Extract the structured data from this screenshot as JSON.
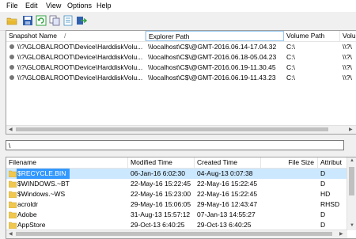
{
  "menu": [
    "File",
    "Edit",
    "View",
    "Options",
    "Help"
  ],
  "toolbar": [
    {
      "name": "open-folder-icon",
      "color": "#e8b830"
    },
    {
      "name": "save-icon",
      "color": "#3060b0"
    },
    {
      "name": "refresh-icon",
      "color": "#30a040"
    },
    {
      "name": "copy-icon",
      "color": "#8080c0"
    },
    {
      "name": "properties-icon",
      "color": "#3a8ac0"
    },
    {
      "name": "exit-icon",
      "color": "#3060b0"
    }
  ],
  "snapshots": {
    "columns": [
      "Snapshot Name",
      "Explorer Path",
      "Volume Path",
      "Volu"
    ],
    "sort_indicator": "/",
    "rows": [
      {
        "name": "\\\\?\\GLOBALROOT\\Device\\HarddiskVolu...",
        "explorer": "\\\\localhost\\C$\\@GMT-2016.06.14-17.04.32",
        "volume": "C:\\",
        "vol2": "\\\\?\\"
      },
      {
        "name": "\\\\?\\GLOBALROOT\\Device\\HarddiskVolu...",
        "explorer": "\\\\localhost\\C$\\@GMT-2016.06.18-05.04.23",
        "volume": "C:\\",
        "vol2": "\\\\?\\"
      },
      {
        "name": "\\\\?\\GLOBALROOT\\Device\\HarddiskVolu...",
        "explorer": "\\\\localhost\\C$\\@GMT-2016.06.19-11.30.45",
        "volume": "C:\\",
        "vol2": "\\\\?\\"
      },
      {
        "name": "\\\\?\\GLOBALROOT\\Device\\HarddiskVolu...",
        "explorer": "\\\\localhost\\C$\\@GMT-2016.06.19-11.43.23",
        "volume": "C:\\",
        "vol2": "\\\\?\\"
      }
    ]
  },
  "path": "\\",
  "files": {
    "columns": [
      "Filename",
      "Modified Time",
      "Created Time",
      "File Size",
      "Attribut"
    ],
    "sort_indicator": "/",
    "rows": [
      {
        "name": "$RECYCLE.BIN",
        "modified": "06-Jan-16 6:02:30",
        "created": "04-Aug-13 0:07:38",
        "size": "",
        "attr": "D",
        "selected": true
      },
      {
        "name": "$WINDOWS.~BT",
        "modified": "22-May-16 15:22:45",
        "created": "22-May-16 15:22:45",
        "size": "",
        "attr": "D",
        "selected": false
      },
      {
        "name": "$Windows.~WS",
        "modified": "22-May-16 15:23:00",
        "created": "22-May-16 15:22:45",
        "size": "",
        "attr": "HD",
        "selected": false
      },
      {
        "name": "acroldr",
        "modified": "29-May-16 15:06:05",
        "created": "29-May-16 12:43:47",
        "size": "",
        "attr": "RHSD",
        "selected": false
      },
      {
        "name": "Adobe",
        "modified": "31-Aug-13 15:57:12",
        "created": "07-Jan-13 14:55:27",
        "size": "",
        "attr": "D",
        "selected": false
      },
      {
        "name": "AppStore",
        "modified": "29-Oct-13 6:40:25",
        "created": "29-Oct-13 6:40:25",
        "size": "",
        "attr": "D",
        "selected": false
      }
    ]
  }
}
